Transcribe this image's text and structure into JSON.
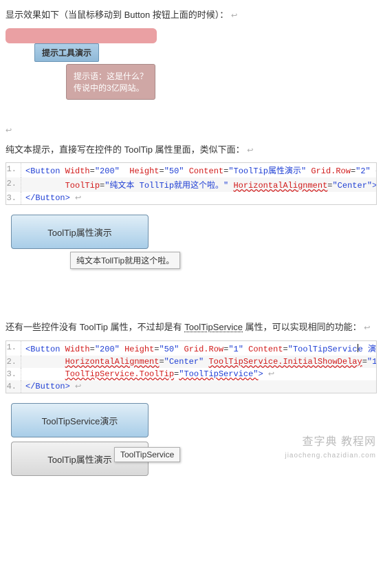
{
  "para1": "显示效果如下（当鼠标移动到 Button 按钮上面的时候）：",
  "fig1": {
    "button_label": "提示工具演示",
    "tooltip_line1": "提示语：这是什么？",
    "tooltip_line2": "传说中的3亿网站。"
  },
  "para2": "纯文本提示，直接写在控件的 ToolTip 属性里面，类似下面：",
  "code1": {
    "width": "\"200\"",
    "height": "\"50\"",
    "content": "\"ToolTip属性演示\"",
    "grid_row": "\"2\"",
    "tooltip_val": "\"纯文本 TollTip就用这个啦。\"",
    "halign_attr": "HorizontalAlignment",
    "halign_val": "\"Center\""
  },
  "fig2": {
    "button_label": "ToolTip属性演示",
    "tooltip_text": "纯文本TollTip就用这个啦。"
  },
  "para3_a": "还有一些控件没有 ToolTip 属性，不过却是有 ",
  "para3_u": "ToolTipService",
  "para3_b": " 属性，可以实现相同的功能：",
  "code2": {
    "width": "\"200\"",
    "height": "\"50\"",
    "grid_row": "\"1\"",
    "content": "\"ToolTipService 演示\"",
    "halign_val": "\"Center\"",
    "ishow_attr": "ToolTipService.InitialShowDelay",
    "ishow_val": "\"1\"",
    "tts_attr": "ToolTipService.ToolTip",
    "tts_val": "\"ToolTipService\""
  },
  "fig3": {
    "button1_label": "ToolTipService演示",
    "button2_label": "ToolTip属性演示",
    "tooltip_text": "ToolTipService"
  },
  "watermark": "查字典 教程网",
  "watermark_url": "jiaocheng.chazidian.com"
}
